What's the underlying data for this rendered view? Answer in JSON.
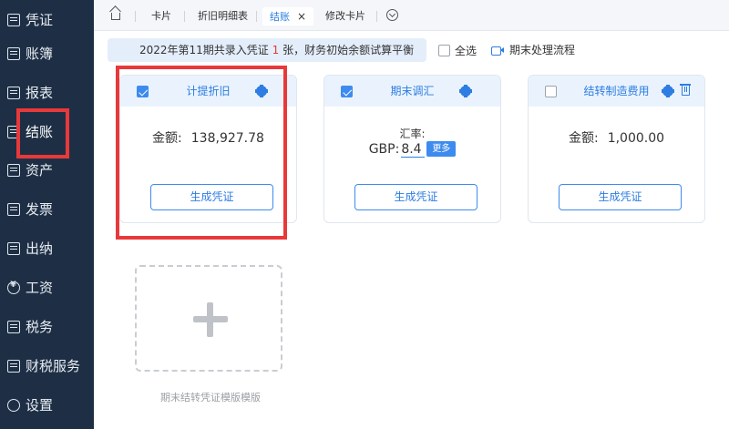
{
  "sidebar": {
    "items": [
      {
        "label": "凭证",
        "icon": "document-icon"
      },
      {
        "label": "账簿",
        "icon": "book-icon"
      },
      {
        "label": "报表",
        "icon": "report-icon"
      },
      {
        "label": "结账",
        "icon": "checkout-icon"
      },
      {
        "label": "资产",
        "icon": "asset-icon"
      },
      {
        "label": "发票",
        "icon": "invoice-icon"
      },
      {
        "label": "出纳",
        "icon": "cashier-icon"
      },
      {
        "label": "工资",
        "icon": "yen-icon"
      },
      {
        "label": "税务",
        "icon": "tax-icon"
      },
      {
        "label": "财税服务",
        "icon": "service-icon"
      },
      {
        "label": "设置",
        "icon": "settings-icon"
      }
    ],
    "active": "结账"
  },
  "tabs": [
    {
      "label": "卡片"
    },
    {
      "label": "折旧明细表"
    },
    {
      "label": "结账",
      "close": "×"
    },
    {
      "label": "修改卡片"
    }
  ],
  "banner": {
    "prefix": "2022年第11期共录入凭证 ",
    "count": "1",
    "suffix": " 张，财务初始余额试算平衡"
  },
  "select_all_label": "全选",
  "flow_link_label": "期末处理流程",
  "cards": [
    {
      "title": "计提折旧",
      "checked": true,
      "amount_label": "金额:",
      "amount": "138,927.78",
      "button": "生成凭证"
    },
    {
      "title": "期末调汇",
      "checked": true,
      "rate_label": "汇率:",
      "currency": "GBP:",
      "rate_value": "8.4",
      "more": "更多",
      "button": "生成凭证"
    },
    {
      "title": "结转制造费用",
      "checked": false,
      "amount_label": "金额:",
      "amount": "1,000.00",
      "button": "生成凭证"
    }
  ],
  "add_template_label": "期末结转凭证模版模版",
  "colors": {
    "sidebar_bg": "#1e2f45",
    "accent": "#2d7de2",
    "highlight": "#e8393a"
  }
}
